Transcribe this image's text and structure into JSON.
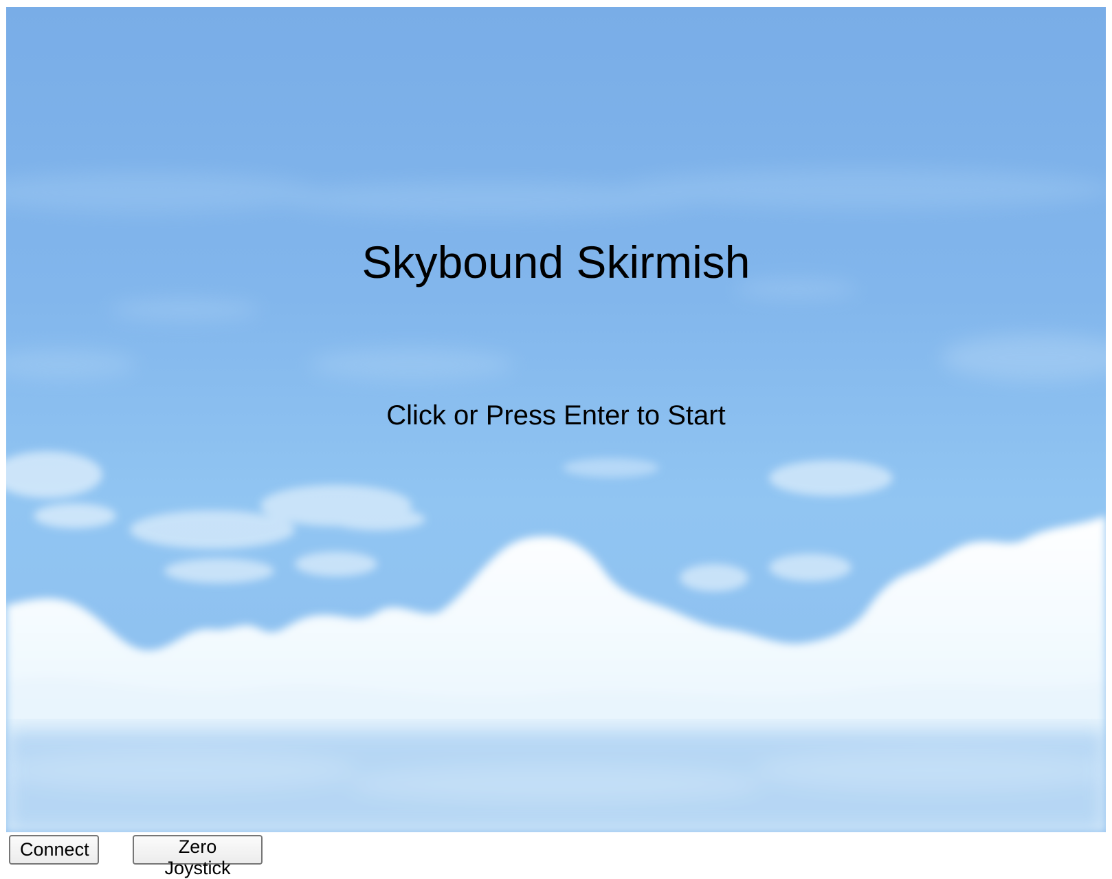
{
  "game": {
    "title": "Skybound Skirmish",
    "start_prompt": "Click or Press Enter to Start"
  },
  "controls": {
    "connect_label": "Connect",
    "zero_joystick_label": "Zero Joystick"
  },
  "colors": {
    "sky_top": "#7aaee8",
    "sky_mid": "#8cc0f0",
    "sky_low": "#93c6f2",
    "cloud_white": "#f4fbff",
    "cloud_shade": "#d6ecfb"
  }
}
